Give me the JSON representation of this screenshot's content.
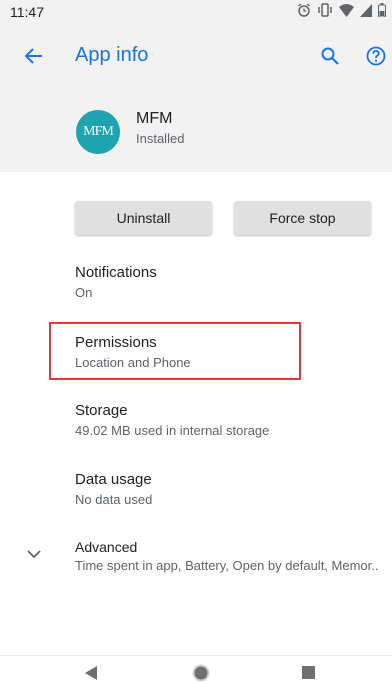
{
  "status_bar": {
    "time": "11:47",
    "icons": [
      "alarm-icon",
      "vibrate-icon",
      "wifi-icon",
      "signal-icon",
      "battery-icon"
    ]
  },
  "header": {
    "title": "App info",
    "back_icon": "arrow-back-icon",
    "search_icon": "search-icon",
    "help_icon": "help-icon"
  },
  "app": {
    "icon_text": "MFM",
    "name": "MFM",
    "status": "Installed"
  },
  "buttons": {
    "uninstall": "Uninstall",
    "force_stop": "Force stop"
  },
  "items": [
    {
      "title": "Notifications",
      "subtitle": "On"
    },
    {
      "title": "Permissions",
      "subtitle": "Location and Phone"
    },
    {
      "title": "Storage",
      "subtitle": "49.02 MB used in internal storage"
    },
    {
      "title": "Data usage",
      "subtitle": "No data used"
    },
    {
      "title": "Advanced",
      "subtitle": "Time spent in app, Battery, Open by default, Memor.."
    }
  ],
  "colors": {
    "accent": "#1a73e8",
    "app_icon_bg": "#1ea3b1",
    "highlight": "#e53935"
  },
  "nav_bar": {
    "icons": [
      "nav-back-icon",
      "nav-home-icon",
      "nav-recents-icon"
    ]
  }
}
